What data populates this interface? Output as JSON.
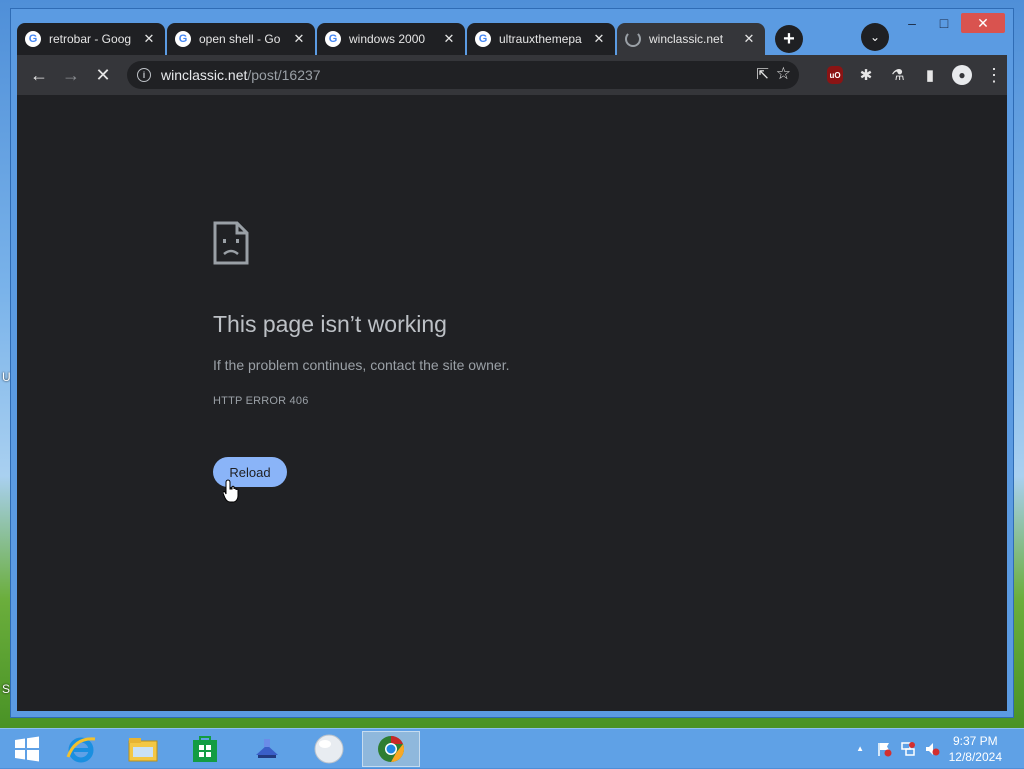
{
  "desktop": {
    "glyphs": [
      "U",
      "S"
    ]
  },
  "window": {
    "caption": {
      "minimize": "–",
      "maximize": "□",
      "close": "✕"
    }
  },
  "tabs": [
    {
      "title": "retrobar - Goog",
      "favicon": "google-g-icon",
      "active": false
    },
    {
      "title": "open shell - Go",
      "favicon": "google-g-icon",
      "active": false
    },
    {
      "title": "windows 2000",
      "favicon": "google-g-icon",
      "active": false
    },
    {
      "title": "ultrauxthemepa",
      "favicon": "google-g-icon",
      "active": false
    },
    {
      "title": "winclassic.net",
      "favicon": "loading-spinner-icon",
      "active": true
    }
  ],
  "toolbar": {
    "back": "←",
    "forward": "→",
    "stop": "✕",
    "url_host": "winclassic.net",
    "url_path": "/post/16237",
    "share": "⇱",
    "star": "☆",
    "ublock_label": "uO",
    "extensions": "✱",
    "labs": "⚗",
    "sidepanel": "▮",
    "profile": "●",
    "menu": "⋮"
  },
  "error_page": {
    "title": "This page isn’t working",
    "description": "If the problem continues, contact the site owner.",
    "code": "HTTP ERROR 406",
    "reload_label": "Reload"
  },
  "taskbar": {
    "items": [
      "start-icon",
      "internet-explorer-icon",
      "file-explorer-icon",
      "store-icon",
      "network-app-icon",
      "white-orb-icon",
      "chrome-icon"
    ],
    "active_item": "chrome-icon",
    "tray": {
      "arrow": "▲",
      "time": "9:37 PM",
      "date": "12/8/2024"
    }
  },
  "colors": {
    "content_bg": "#202124",
    "toolbar_bg": "#35363a",
    "accent": "#8ab4f8",
    "window_frame": "#5b9be2"
  }
}
